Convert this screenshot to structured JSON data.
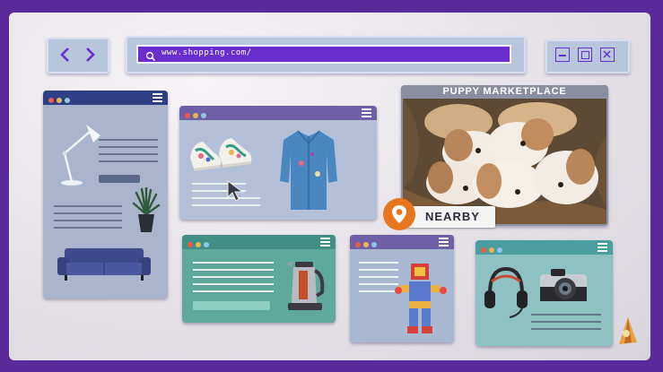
{
  "browser": {
    "url": "www.shopping.com/",
    "nav_back": "‹",
    "nav_forward": "›"
  },
  "window_controls": {
    "minimize": "–",
    "maximize": "□",
    "close": "✕"
  },
  "puppy_panel": {
    "title": "PUPPY MARKETPLACE"
  },
  "location_badge": {
    "label": "NEARBY"
  },
  "colors": {
    "background_purple": "#5b2a9a",
    "url_bar_purple": "#6a2ed0",
    "panel_blue": "#2f3f86",
    "panel_purple": "#6f5fa6",
    "panel_teal": "#3f8f86",
    "pin_orange": "#e8761f"
  },
  "icons": [
    "search-icon",
    "chevron-left-icon",
    "chevron-right-icon",
    "hamburger-menu-icon",
    "location-pin-icon",
    "cursor-arrow-icon"
  ]
}
